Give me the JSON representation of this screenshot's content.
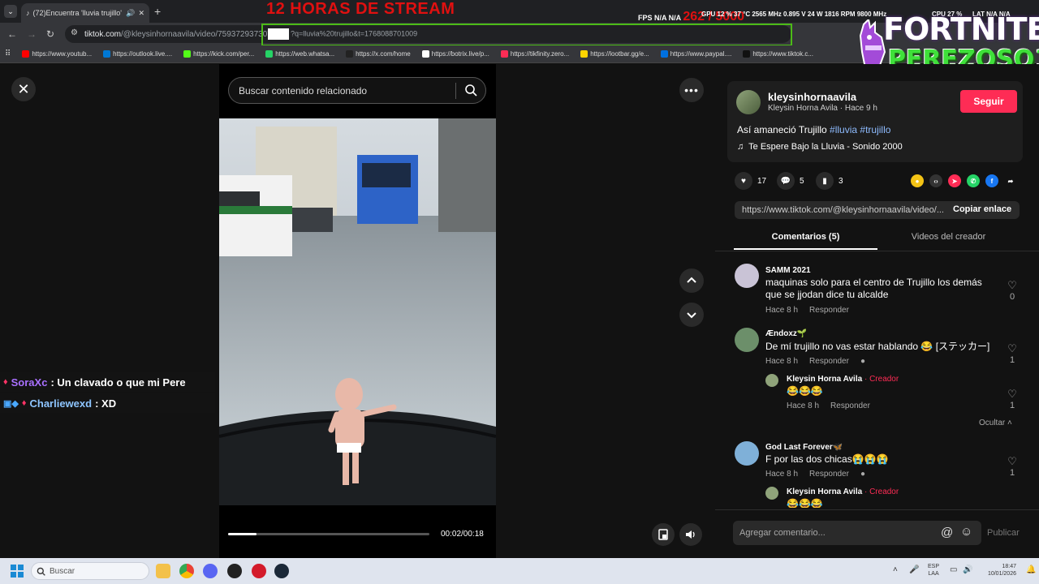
{
  "browser": {
    "tab_title": "(72)Encuentra 'lluvia trujillo'",
    "url_host": "tiktok.com",
    "url_path": "/@kleysinhornaavila/video/7593729373079",
    "url_query": "?q=lluvia%20trujillo&t=1768088701009",
    "bookmarks": [
      {
        "label": "https://www.youtub...",
        "color": "#ff0000"
      },
      {
        "label": "https://outlook.live....",
        "color": "#0078d4"
      },
      {
        "label": "https://kick.com/per...",
        "color": "#53fc18"
      },
      {
        "label": "https://web.whatsa...",
        "color": "#25d366"
      },
      {
        "label": "https://x.com/home",
        "color": "#222222"
      },
      {
        "label": "https://botrix.live/p...",
        "color": "#ffffff"
      },
      {
        "label": "https://tikfinity.zero...",
        "color": "#fe2c55"
      },
      {
        "label": "https://lootbar.gg/e...",
        "color": "#ffd400"
      },
      {
        "label": "https://www.paypal....",
        "color": "#0070e0"
      },
      {
        "label": "https://www.tiktok.c...",
        "color": "#111111"
      }
    ]
  },
  "overlay": {
    "stream_title": "12 HORAS DE STREAM",
    "stats_fps": "FPS N/A N/A",
    "stats_big": "262 / 5000",
    "stats_gpu": "GPU 12 % 37 °C 2565 MHz 0.895 V 24 W 1816 RPM 9800 MHz",
    "stats_cpu": "CPU 27 %",
    "stats_lat": "LAT N/A N/A",
    "logo_top": "FORTNITE",
    "logo_bottom": "PEREZOSO1"
  },
  "chat": [
    {
      "user": "SoraXc",
      "message": ": Un clavado o que mi Pere"
    },
    {
      "user": "Charliewexd",
      "message": ": XD"
    }
  ],
  "player": {
    "search_placeholder": "Buscar contenido relacionado",
    "time": "00:02/00:18",
    "progress": 0.14
  },
  "video_info": {
    "username": "kleysinhornaavila",
    "subline": "Kleysin Horna Avila · Hace 9 h",
    "follow_label": "Seguir",
    "desc_text": "Así amaneció Trujillo ",
    "hashtags": [
      "#lluvia",
      "#trujillo"
    ],
    "music": "Te Espere Bajo la Lluvia - Sonido 2000",
    "likes": "17",
    "comments": "5",
    "saves": "3",
    "link": "https://www.tiktok.com/@kleysinhornaavila/video/...",
    "copy_label": "Copiar enlace"
  },
  "tabs": {
    "comments": "Comentarios (5)",
    "videos": "Videos del creador"
  },
  "comments": [
    {
      "name": "SAMM 2021",
      "text": "maquinas solo para el centro de Trujillo los demás que se jjodan dice tu alcalde",
      "time": "Hace 8 h",
      "reply": "Responder",
      "likes": "0"
    },
    {
      "name": "Ændoxz🌱",
      "text": "De mí trujillo no vas estar hablando 😂 [ステッカー]",
      "time": "Hace 8 h",
      "reply": "Responder",
      "likes": "1"
    },
    {
      "name": "Kleysin Horna Avila",
      "badge": " · Creador",
      "text": "😂😂😂",
      "time": "Hace 8 h",
      "reply": "Responder",
      "likes": "1"
    },
    {
      "name": "God Last Forever🦋",
      "text": "F por las dos chicas😭😭😭",
      "time": "Hace 8 h",
      "reply": "Responder",
      "likes": "1"
    },
    {
      "name": "Kleysin Horna Avila",
      "badge": " · Creador",
      "text": "😂😂😂"
    }
  ],
  "hide_label": "Ocultar",
  "comment_placeholder": "Agregar comentario...",
  "publish_label": "Publicar",
  "taskbar": {
    "search_label": "Buscar",
    "lang_top": "ESP",
    "lang_bottom": "LAA",
    "time": "18:47",
    "date": "10/01/2026"
  }
}
